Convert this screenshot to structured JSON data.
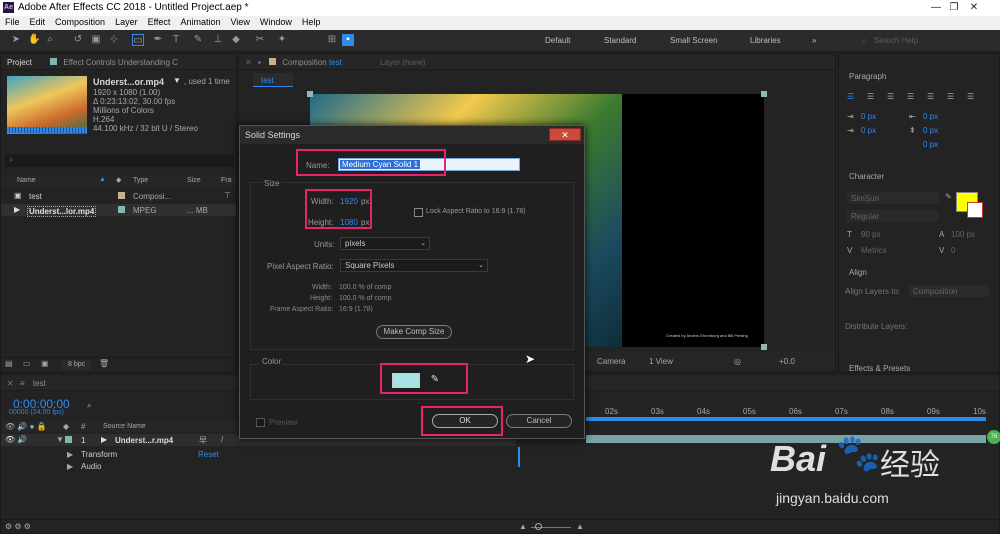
{
  "app": {
    "logo": "Ae",
    "title": "Adobe After Effects CC 2018 - Untitled Project.aep *",
    "window_controls": [
      "—",
      "❐",
      "✕"
    ]
  },
  "menu": [
    "File",
    "Edit",
    "Composition",
    "Layer",
    "Effect",
    "Animation",
    "View",
    "Window",
    "Help"
  ],
  "workspaces": [
    "Default",
    "Standard",
    "Small Screen",
    "Libraries"
  ],
  "search_help_placeholder": "Search Help",
  "project_panel": {
    "tab": "Project",
    "effect_controls_tab": "Effect Controls Understanding C",
    "footage_name": "Underst...or.mp4",
    "used": ", used 1 time",
    "info_lines": [
      "1920 x 1080 (1.00)",
      "Δ 0:23:13:02, 30.00 fps",
      "Millions of Colors",
      "H.264",
      "44.100 kHz / 32 bit U / Stereo"
    ],
    "columns": [
      "Name",
      "Type",
      "Size",
      "Fra"
    ],
    "items": [
      {
        "name": "test",
        "type": "Composi...",
        "size": ""
      },
      {
        "name": "Underst...lor.mp4",
        "type": "MPEG",
        "size": "... MB"
      }
    ],
    "bpc": "8 bpc"
  },
  "comp_panel": {
    "tab_prefix": "Composition",
    "tab_name": "test",
    "layer_tab": "Layer (none)",
    "subtab": "test",
    "credit": "Created by Anders Ehrenborg and Bill Presing",
    "camera": "Camera",
    "view": "1 View",
    "offset": "+0.0"
  },
  "right_panel": {
    "paragraph": "Paragraph",
    "px_values": [
      "0 px",
      "0 px",
      "0 px",
      "0 px",
      "0 px"
    ],
    "character": "Character",
    "font": "SimSun",
    "style": "Regular",
    "size": "90 px",
    "leading": "100 px",
    "metrics": "Metrics",
    "tracking": "0",
    "align": "Align",
    "align_to_label": "Align Layers to:",
    "align_to_value": "Composition",
    "distribute": "Distribute Layers:",
    "effects": "Effects & Presets",
    "fill_color": "#ffff00"
  },
  "timeline": {
    "tab": "test",
    "timecode": "0:00:00:00",
    "frames": "00000 (24.00 fps)",
    "source_name_col": "Source Name",
    "layer_num": "1",
    "layer_name": "Underst...r.mp4",
    "transform": "Transform",
    "reset": "Reset",
    "audio": "Audio",
    "ruler": [
      "02s",
      "03s",
      "04s",
      "05s",
      "06s",
      "07s",
      "08s",
      "09s",
      "10s"
    ],
    "badge": "76"
  },
  "dialog": {
    "title": "Solid Settings",
    "close": "✕",
    "name_label": "Name:",
    "name_value": "Medium Cyan Solid 1",
    "size_group": "Size",
    "width_label": "Width:",
    "width_value": "1920",
    "height_label": "Height:",
    "height_value": "1080",
    "px_unit": "px",
    "lock_aspect": "Lock Aspect Ratio to 16:9 (1.78)",
    "units_label": "Units:",
    "units_value": "pixels",
    "par_label": "Pixel Aspect Ratio:",
    "par_value": "Square Pixels",
    "info_width_label": "Width:",
    "info_width_value": "100.0 % of comp",
    "info_height_label": "Height:",
    "info_height_value": "100.0 % of comp",
    "far_label": "Frame Aspect Ratio:",
    "far_value": "16:9 (1.78)",
    "make_comp_size": "Make Comp Size",
    "color_group": "Color",
    "swatch_color": "#a6e3e3",
    "preview": "Preview",
    "ok": "OK",
    "cancel": "Cancel"
  },
  "watermark": {
    "brand": "Bai",
    "brand_cn": "经验",
    "url": "jingyan.baidu.com"
  }
}
